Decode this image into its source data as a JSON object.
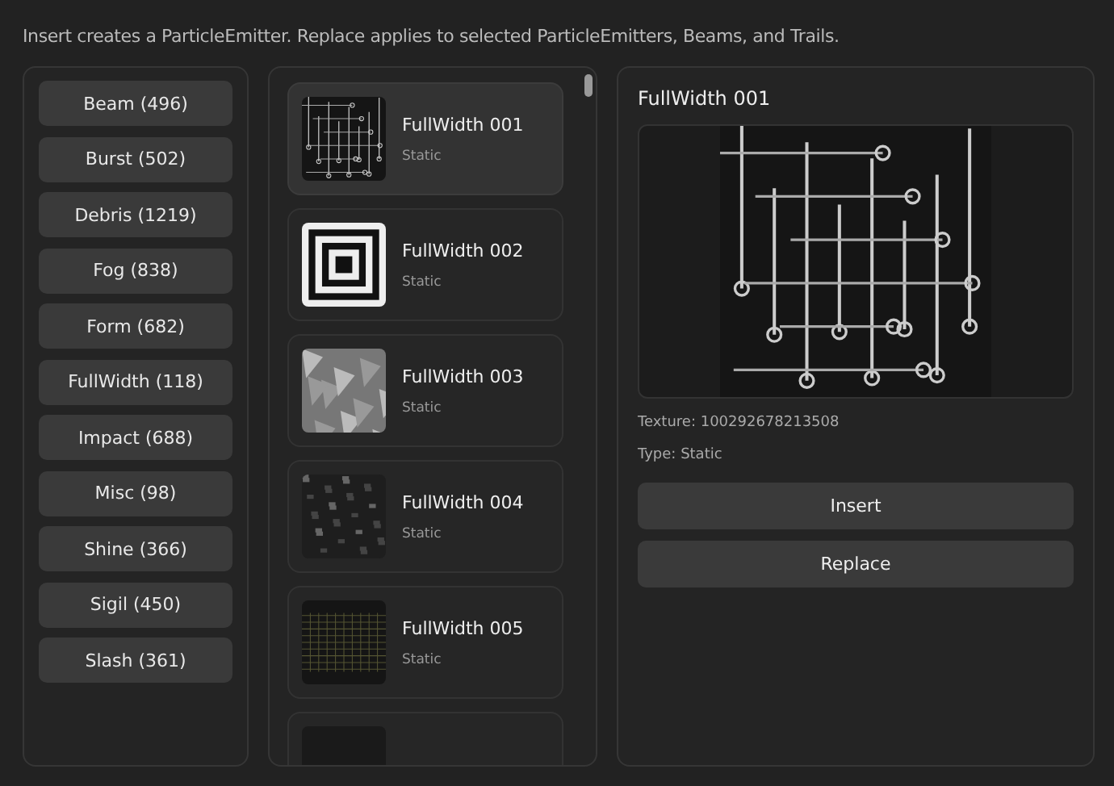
{
  "hint": "Insert creates a ParticleEmitter. Replace applies to selected ParticleEmitters, Beams, and Trails.",
  "categories": [
    "Beam (496)",
    "Burst (502)",
    "Debris (1219)",
    "Fog (838)",
    "Form (682)",
    "FullWidth (118)",
    "Impact (688)",
    "Misc (98)",
    "Shine (366)",
    "Sigil (450)",
    "Slash (361)"
  ],
  "items": [
    {
      "name": "FullWidth 001",
      "type": "Static",
      "kind": "circuit",
      "selected": true
    },
    {
      "name": "FullWidth 002",
      "type": "Static",
      "kind": "squares",
      "selected": false
    },
    {
      "name": "FullWidth 003",
      "type": "Static",
      "kind": "shards",
      "selected": false
    },
    {
      "name": "FullWidth 004",
      "type": "Static",
      "kind": "noise",
      "selected": false
    },
    {
      "name": "FullWidth 005",
      "type": "Static",
      "kind": "grid",
      "selected": false
    },
    {
      "kind": "dark",
      "selected": false
    }
  ],
  "detail": {
    "title": "FullWidth 001",
    "kind": "circuit",
    "texture": "Texture: 100292678213508",
    "type": "Type: Static",
    "buttons": [
      "Insert",
      "Replace"
    ]
  }
}
